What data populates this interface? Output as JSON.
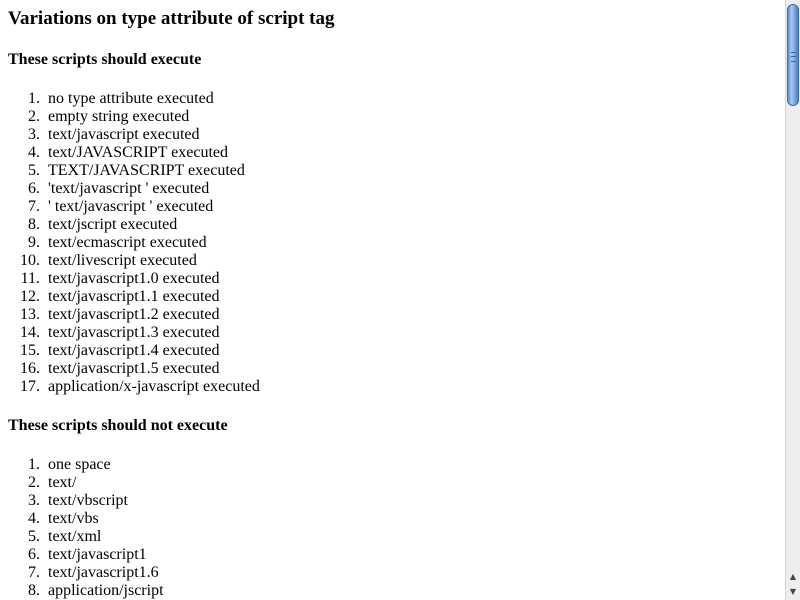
{
  "page": {
    "title": "Variations on type attribute of script tag"
  },
  "exec_section": {
    "heading": "These scripts should execute",
    "items": [
      {
        "num": "1.",
        "text": "no type attribute executed"
      },
      {
        "num": "2.",
        "text": "empty string executed"
      },
      {
        "num": "3.",
        "text": "text/javascript executed"
      },
      {
        "num": "4.",
        "text": "text/JAVASCRIPT executed"
      },
      {
        "num": "5.",
        "text": "TEXT/JAVASCRIPT executed"
      },
      {
        "num": "6.",
        "text": "'text/javascript ' executed"
      },
      {
        "num": "7.",
        "text": "' text/javascript ' executed"
      },
      {
        "num": "8.",
        "text": "text/jscript executed"
      },
      {
        "num": "9.",
        "text": "text/ecmascript executed"
      },
      {
        "num": "10.",
        "text": "text/livescript executed"
      },
      {
        "num": "11.",
        "text": "text/javascript1.0 executed"
      },
      {
        "num": "12.",
        "text": "text/javascript1.1 executed"
      },
      {
        "num": "13.",
        "text": "text/javascript1.2 executed"
      },
      {
        "num": "14.",
        "text": "text/javascript1.3 executed"
      },
      {
        "num": "15.",
        "text": "text/javascript1.4 executed"
      },
      {
        "num": "16.",
        "text": "text/javascript1.5 executed"
      },
      {
        "num": "17.",
        "text": "application/x-javascript executed"
      }
    ]
  },
  "noexec_section": {
    "heading": "These scripts should not execute",
    "items": [
      {
        "num": "1.",
        "text": "one space"
      },
      {
        "num": "2.",
        "text": "text/"
      },
      {
        "num": "3.",
        "text": "text/vbscript"
      },
      {
        "num": "4.",
        "text": "text/vbs"
      },
      {
        "num": "5.",
        "text": "text/xml"
      },
      {
        "num": "6.",
        "text": "text/javascript1"
      },
      {
        "num": "7.",
        "text": "text/javascript1.6"
      },
      {
        "num": "8.",
        "text": "application/jscript"
      }
    ]
  },
  "scrollbar": {
    "up_glyph": "▲",
    "down_glyph": "▼"
  }
}
